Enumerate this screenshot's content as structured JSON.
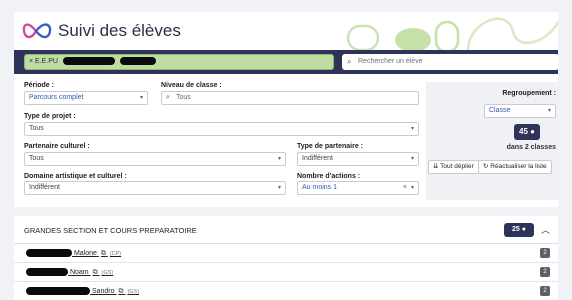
{
  "app": {
    "title": "Suivi des élèves"
  },
  "search": {
    "filter_chip": "× E.E.PU",
    "placeholder": "Rechercher un élève"
  },
  "filters": {
    "periode": {
      "label": "Période :",
      "value": "Parcours complet"
    },
    "niveau": {
      "label": "Niveau de classe :",
      "placeholder": "Tous"
    },
    "type_projet": {
      "label": "Type de projet :",
      "value": "Tous"
    },
    "partenaire": {
      "label": "Partenaire culturel :",
      "value": "Tous"
    },
    "type_partenaire": {
      "label": "Type de partenaire :",
      "value": "Indifférent"
    },
    "domaine": {
      "label": "Domaine artistique et culturel :",
      "value": "Indifférent"
    },
    "nb_actions": {
      "label": "Nombre d'actions :",
      "value": "Au moins 1"
    }
  },
  "grouping": {
    "label": "Regroupement :",
    "value": "Classe",
    "count": "45",
    "classes_text": "dans 2 classes",
    "expand_button": "Tout déplier",
    "refresh_button": "Réactualiser la liste"
  },
  "section": {
    "title": "GRANDES SECTION ET COURS PREPARATOIRE",
    "count": "25",
    "students": [
      {
        "name": "Malone",
        "level": "(CP)",
        "count": "2"
      },
      {
        "name": "Noam",
        "level": "(GS)",
        "count": "2"
      },
      {
        "name": "Sandro",
        "level": "(GS)",
        "count": "2"
      }
    ]
  },
  "colors": {
    "navy": "#2e3358",
    "green": "#bfdca4",
    "accent_blue": "#2d5bb0"
  }
}
